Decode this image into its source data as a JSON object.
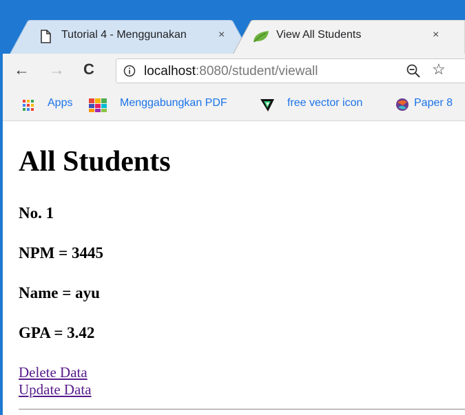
{
  "browser": {
    "tabs": [
      {
        "title": "Tutorial 4 - Menggunakan",
        "close": "×",
        "active": false
      },
      {
        "title": "View All Students",
        "close": "×",
        "active": true
      }
    ],
    "nav": {
      "back": "←",
      "forward": "→",
      "reload": "C"
    },
    "address": {
      "host": "localhost",
      "rest": ":8080/student/viewall"
    },
    "bookmarks": [
      "Apps",
      "Menggabungkan PDF",
      "free vector icon",
      "Paper 8"
    ]
  },
  "page": {
    "heading": "All Students",
    "student": {
      "no": "No. 1",
      "npm": "NPM = 3445",
      "name": "Name = ayu",
      "gpa": "GPA = 3.42"
    },
    "links": {
      "delete": "Delete Data",
      "update": "Update Data"
    }
  },
  "colors": {
    "titlebar": "#1f78d1",
    "link_visited": "#551a8b"
  }
}
